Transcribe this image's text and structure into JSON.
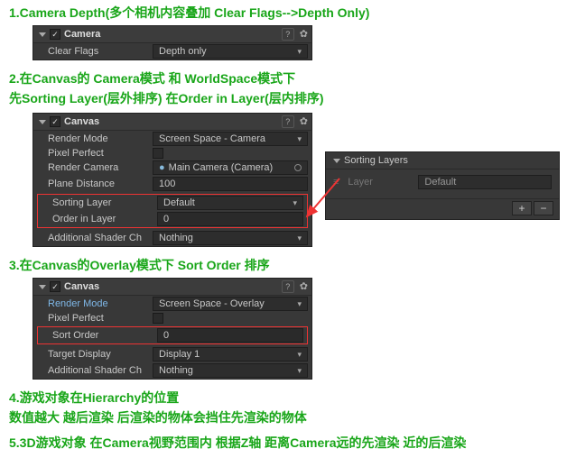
{
  "headings": {
    "h1": "1.Camera Depth(多个相机内容叠加  Clear Flags-->Depth Only)",
    "h2": "2.在Canvas的 Camera模式 和 WorldSpace模式下",
    "h2b": "   先Sorting Layer(层外排序)   在Order in Layer(层内排序)",
    "h3": "3.在Canvas的Overlay模式下 Sort Order 排序",
    "h4": "4.游戏对象在Hierarchy的位置",
    "h4b": "数值越大 越后渲染 后渲染的物体会挡住先渲染的物体",
    "h5": "5.3D游戏对象  在Camera视野范围内 根据Z轴 距离Camera远的先渲染 近的后渲染"
  },
  "camera": {
    "title": "Camera",
    "checked": "✓",
    "clear_flags_label": "Clear Flags",
    "clear_flags_value": "Depth only"
  },
  "canvas1": {
    "title": "Canvas",
    "checked": "✓",
    "render_mode_label": "Render Mode",
    "render_mode_value": "Screen Space - Camera",
    "pixel_perfect_label": "Pixel Perfect",
    "render_camera_label": "Render Camera",
    "render_camera_value": "Main Camera (Camera)",
    "plane_distance_label": "Plane Distance",
    "plane_distance_value": "100",
    "sorting_layer_label": "Sorting Layer",
    "sorting_layer_value": "Default",
    "order_in_layer_label": "Order in Layer",
    "order_in_layer_value": "0",
    "shader_label": "Additional Shader Ch",
    "shader_value": "Nothing"
  },
  "sorting_layers": {
    "title": "Sorting Layers",
    "layer_label": "Layer",
    "layer_value": "Default",
    "plus": "+",
    "minus": "−"
  },
  "canvas2": {
    "title": "Canvas",
    "checked": "✓",
    "render_mode_label": "Render Mode",
    "render_mode_value": "Screen Space - Overlay",
    "pixel_perfect_label": "Pixel Perfect",
    "sort_order_label": "Sort Order",
    "sort_order_value": "0",
    "target_display_label": "Target Display",
    "target_display_value": "Display 1",
    "shader_label": "Additional Shader Ch",
    "shader_value": "Nothing"
  },
  "icons": {
    "question": "?",
    "gear": "✿"
  }
}
